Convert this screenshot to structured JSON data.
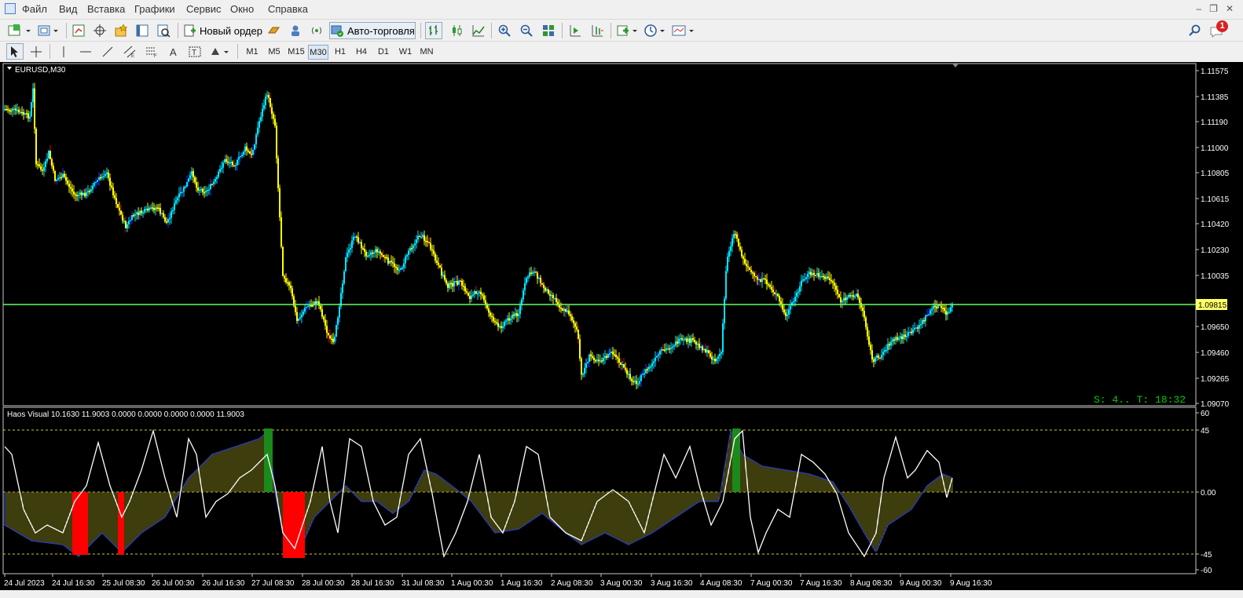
{
  "menu": {
    "items": [
      "Файл",
      "Вид",
      "Вставка",
      "Графики",
      "Сервис",
      "Окно",
      "Справка"
    ]
  },
  "toolbar": {
    "new_order_label": "Новый ордер",
    "autotrading_label": "Авто-торговля",
    "notification_count": "1"
  },
  "timeframes": [
    "M1",
    "M5",
    "M15",
    "M30",
    "H1",
    "H4",
    "D1",
    "W1",
    "MN"
  ],
  "active_timeframe": "M30",
  "chart": {
    "title": "EURUSD,M30",
    "current_price": "1.09815",
    "countdown_text": "S: 4.. T: 18:32",
    "price_scale": [
      "1.11575",
      "1.11385",
      "1.11190",
      "1.11000",
      "1.10805",
      "1.10615",
      "1.10420",
      "1.10230",
      "1.10035",
      "1.09650",
      "1.09460",
      "1.09265",
      "1.09070"
    ],
    "x_labels": [
      "24 Jul 2023",
      "24 Jul 16:30",
      "25 Jul 08:30",
      "26 Jul 00:30",
      "26 Jul 16:30",
      "27 Jul 08:30",
      "28 Jul 00:30",
      "28 Jul 16:30",
      "31 Jul 08:30",
      "1 Aug 00:30",
      "1 Aug 16:30",
      "2 Aug 08:30",
      "3 Aug 00:30",
      "3 Aug 16:30",
      "4 Aug 08:30",
      "7 Aug 00:30",
      "7 Aug 16:30",
      "8 Aug 08:30",
      "9 Aug 00:30",
      "9 Aug 16:30"
    ],
    "up_color": "#00e5ff",
    "down_color": "#ffff00",
    "price_line_color": "#66ff66"
  },
  "indicator": {
    "title": "Haos Visual 10.1630 11.9003 0.0000 0.0000 0.0000 0.0000 11.9003",
    "scale": [
      "60",
      "45",
      "0.00",
      "-45",
      "-60"
    ]
  }
}
